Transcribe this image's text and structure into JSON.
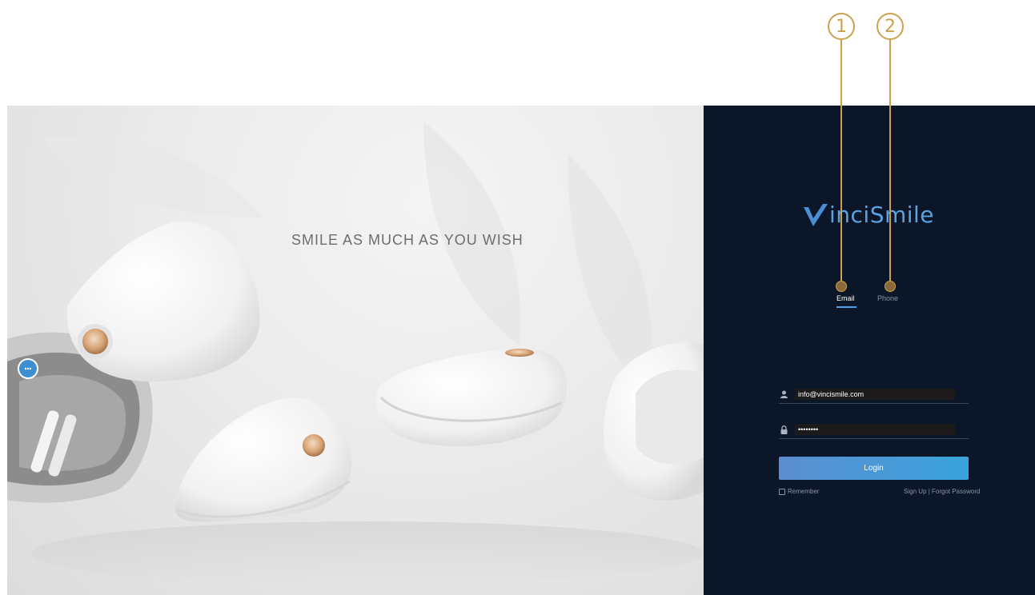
{
  "annotations": {
    "callouts": [
      {
        "number": "1"
      },
      {
        "number": "2"
      }
    ],
    "color": "#c9a34c"
  },
  "hero": {
    "title": "SMILE AS MUCH AS YOU WISH",
    "chat_icon": "chat-ellipsis-icon"
  },
  "login": {
    "brand": {
      "logo_text": "inciSmile",
      "logo_letter_icon": "v-check-logo-icon",
      "color": "#5aa3e0"
    },
    "tabs": [
      {
        "label": "Email",
        "active": true
      },
      {
        "label": "Phone",
        "active": false
      }
    ],
    "email": {
      "value": "info@vincismile.com",
      "icon": "user-icon"
    },
    "password": {
      "value": "••••••••",
      "icon": "lock-icon"
    },
    "login_button": "Login",
    "remember_label": "Remember",
    "signup_link": "Sign Up",
    "separator": " | ",
    "forgot_link": "Forgot Password",
    "background": "#0b1628",
    "accent": "#4ea3e6"
  }
}
